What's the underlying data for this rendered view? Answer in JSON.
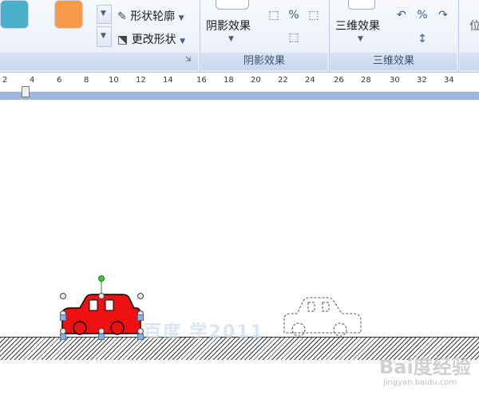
{
  "ribbon": {
    "shape_outline_label": "形状轮廓",
    "change_shape_label": "更改形状",
    "shadow_effects_button": "阴影效果",
    "shadow_group_label": "阴影效果",
    "threed_effects_button": "三维效果",
    "threed_group_label": "三维效果",
    "position_partial": "位",
    "swatch_colors": [
      "#4bafc9",
      "#f79b4a"
    ]
  },
  "ruler": {
    "numbers": [
      "2",
      "4",
      "6",
      "8",
      "10",
      "12",
      "14",
      "16",
      "18",
      "20",
      "22",
      "24",
      "26",
      "28",
      "30",
      "32",
      "34"
    ]
  },
  "document": {
    "red_car_color": "#ee1111",
    "watermark_text": "百度  学2011",
    "baidu_logo": "Bai度经验",
    "baidu_site": "jingyan.baidu.com"
  }
}
